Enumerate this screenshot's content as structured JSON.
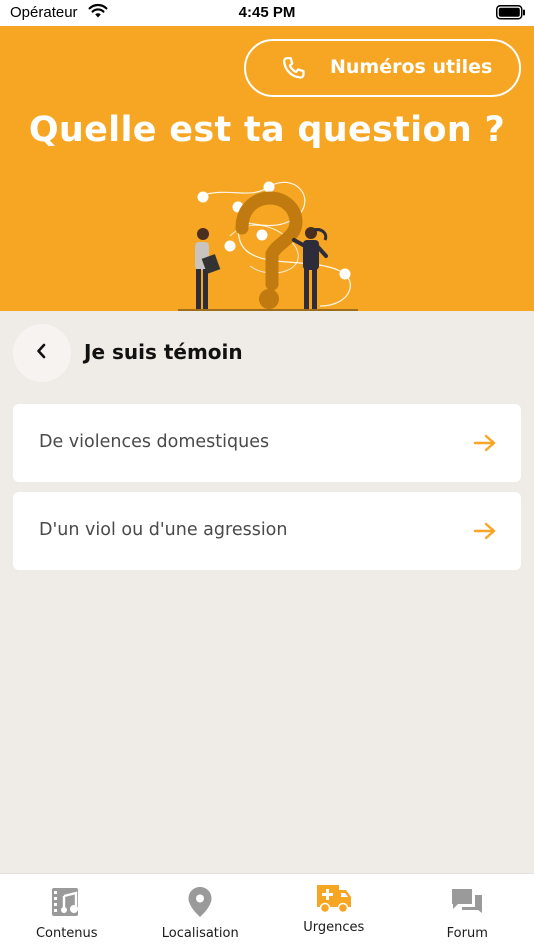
{
  "status_bar": {
    "carrier": "Opérateur",
    "time": "4:45 PM"
  },
  "header": {
    "phone_button_label": "Numéros utiles",
    "title": "Quelle est ta question ?",
    "accent_color": "#f6a623"
  },
  "section": {
    "title": "Je suis témoin"
  },
  "options": [
    {
      "label": "De violences domestiques"
    },
    {
      "label": "D'un viol ou d'une agression"
    }
  ],
  "tabbar": {
    "tabs": [
      {
        "label": "Contenus",
        "icon": "film-music-icon",
        "active": false
      },
      {
        "label": "Localisation",
        "icon": "map-pin-icon",
        "active": false
      },
      {
        "label": "Urgences",
        "icon": "ambulance-icon",
        "active": true
      },
      {
        "label": "Forum",
        "icon": "chat-bubbles-icon",
        "active": false
      }
    ]
  }
}
